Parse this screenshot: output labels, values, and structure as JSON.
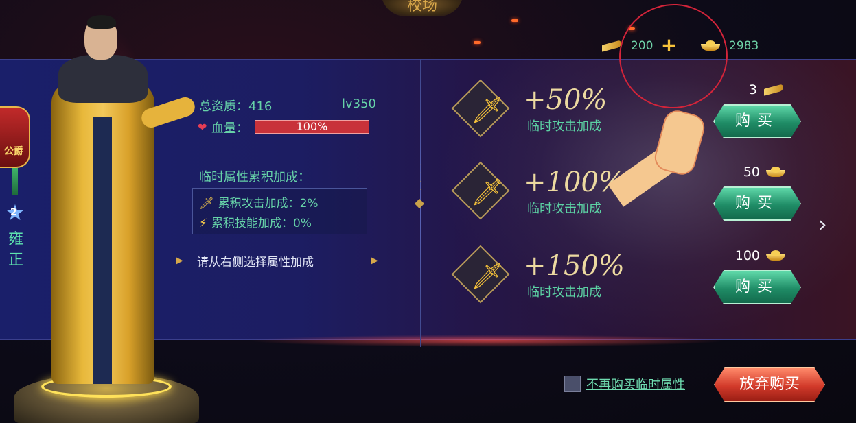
{
  "header": {
    "title_fragment": "校场"
  },
  "currency": {
    "horn_amount": "200",
    "gold_amount": "2983",
    "plus_label": "+"
  },
  "hero": {
    "star_level": "2",
    "name": "雍正",
    "badge": "公爵"
  },
  "stats": {
    "aptitude_label": "总资质：",
    "aptitude_value": "416",
    "level": "lv350",
    "hp_label": "血量：",
    "hp_value": "100%"
  },
  "accumulated": {
    "title": "临时属性累积加成：",
    "attack_label": "累积攻击加成：",
    "attack_value": "2%",
    "skill_label": "累积技能加成：",
    "skill_value": "0%"
  },
  "hint": "请从右侧选择属性加成",
  "offers": [
    {
      "percent": "+50%",
      "desc": "临时攻击加成",
      "price": "3",
      "currency": "horn-icon",
      "button": "购买"
    },
    {
      "percent": "+100%",
      "desc": "临时攻击加成",
      "price": "50",
      "currency": "ingot-icon",
      "button": "购买"
    },
    {
      "percent": "+150%",
      "desc": "临时攻击加成",
      "price": "100",
      "currency": "ingot-icon",
      "button": "购买"
    }
  ],
  "footer": {
    "checkbox_label": "不再购买临时属性",
    "abandon_button": "放弃购买"
  },
  "colors": {
    "accent_green": "#66d2a8",
    "buy_button": "#1f8c66",
    "abandon_button": "#d23a2a",
    "annotation_red": "#d4243a"
  }
}
